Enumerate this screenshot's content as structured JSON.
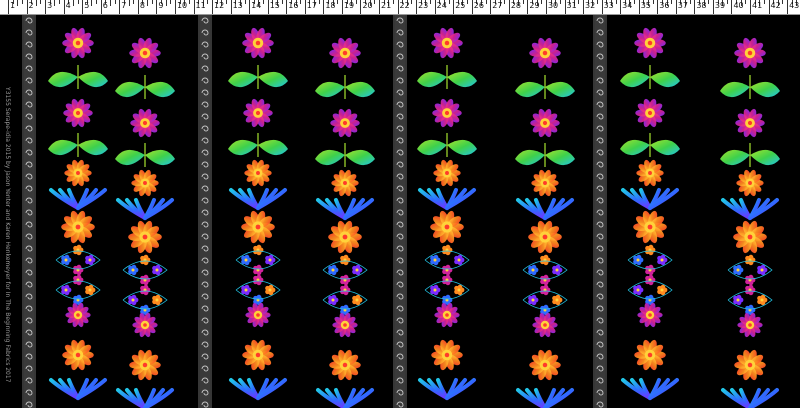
{
  "ruler": {
    "numbers": [
      "1",
      "2",
      "3",
      "4",
      "5",
      "6",
      "7",
      "8",
      "9",
      "10",
      "11",
      "12",
      "13",
      "14",
      "15",
      "16",
      "17",
      "18",
      "19",
      "20",
      "21",
      "22",
      "23",
      "24",
      "25",
      "26",
      "27",
      "28",
      "29",
      "30",
      "31",
      "32",
      "33",
      "34",
      "35",
      "36",
      "37",
      "38",
      "39",
      "40",
      "41",
      "42",
      "43"
    ]
  },
  "selvage": {
    "text": "Y3155 Serape-idia 2015 by Jason Yenter and Karen Henkemeyer for In The Beginning Fabrics 2017"
  },
  "palette": {
    "background": "#000000",
    "border_stripe": "#3a3a3a",
    "swirl": "#c8c8c8",
    "pink": "#ff3b6f",
    "magenta": "#d1229b",
    "purple": "#7a2cff",
    "blue": "#2f6bff",
    "cyan": "#22c6e8",
    "green": "#3fd14a",
    "lime": "#a6e22e",
    "yellow": "#ffd23a",
    "orange": "#ff8a1f",
    "red": "#ff3b2a"
  }
}
